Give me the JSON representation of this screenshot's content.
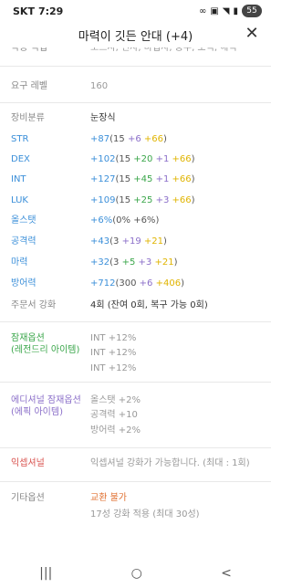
{
  "status": {
    "carrier": "SKT",
    "time": "7:29",
    "battery": "55"
  },
  "header": {
    "title": "마력이 깃든 안대 (+4)"
  },
  "rows": {
    "jobs": {
      "label": "착용 직업",
      "value": "소드사, 전사, 마법사, 궁수, 도적, 해적"
    },
    "level": {
      "label": "요구 레벨",
      "value": "160"
    },
    "category": {
      "label": "장비분류",
      "value": "눈장식"
    },
    "str": {
      "label": "STR",
      "total": "+87",
      "open": "(",
      "base": "15",
      "scroll": "+6",
      "star": "+66",
      "close": ")"
    },
    "dex": {
      "label": "DEX",
      "total": "+102",
      "open": "(",
      "base": "15",
      "flame": "+20",
      "scroll": "+1",
      "star": "+66",
      "close": ")"
    },
    "int": {
      "label": "INT",
      "total": "+127",
      "open": "(",
      "base": "15",
      "flame": "+45",
      "scroll": "+1",
      "star": "+66",
      "close": ")"
    },
    "luk": {
      "label": "LUK",
      "total": "+109",
      "open": "(",
      "base": "15",
      "flame": "+25",
      "scroll": "+3",
      "star": "+66",
      "close": ")"
    },
    "allstat": {
      "label": "올스탯",
      "total": "+6%",
      "detail": "(0% +6%)"
    },
    "atk": {
      "label": "공격력",
      "total": "+43",
      "open": "(",
      "base": "3",
      "scroll": "+19",
      "star": "+21",
      "close": ")"
    },
    "matk": {
      "label": "마력",
      "total": "+32",
      "open": "(",
      "base": "3",
      "flame": "+5",
      "scroll": "+3",
      "star": "+21",
      "close": ")"
    },
    "def": {
      "label": "방어력",
      "total": "+712",
      "open": "(",
      "base": "300",
      "scroll": "+6",
      "star": "+406",
      "close": ")"
    },
    "upgrade": {
      "label": "주문서 강화",
      "value": "4회 (잔여 0회, 복구 가능 0회)"
    },
    "potential": {
      "label1": "잠재옵션",
      "label2": "(레전드리 아이템)",
      "lines": [
        "INT +12%",
        "INT +12%",
        "INT +12%"
      ]
    },
    "additional": {
      "label1": "에디셔널 잠재옵션",
      "label2": "(에픽 아이템)",
      "lines": [
        "올스탯 +2%",
        "공격력 +10",
        "방어력 +2%"
      ]
    },
    "exceptional": {
      "label": "익셉셔널",
      "value": "익셉셔널 강화가 가능합니다. (최대 : 1회)"
    },
    "etc": {
      "label": "기타옵션",
      "line1": "교환 불가",
      "line2": "17성 강화 적용 (최대 30성)"
    }
  },
  "navbar": {
    "recent": "|||",
    "home": "○",
    "back": "<"
  },
  "colors": {
    "stat_blue": "#3b8fd9",
    "flame_green": "#3aa64a",
    "scroll_purple": "#8b6fc9",
    "star_yellow": "#e0b400",
    "potential_green": "#3aa64a",
    "additional_purple": "#8b6fc9",
    "exceptional_red": "#d9534f",
    "untradeable_orange": "#e07030"
  }
}
